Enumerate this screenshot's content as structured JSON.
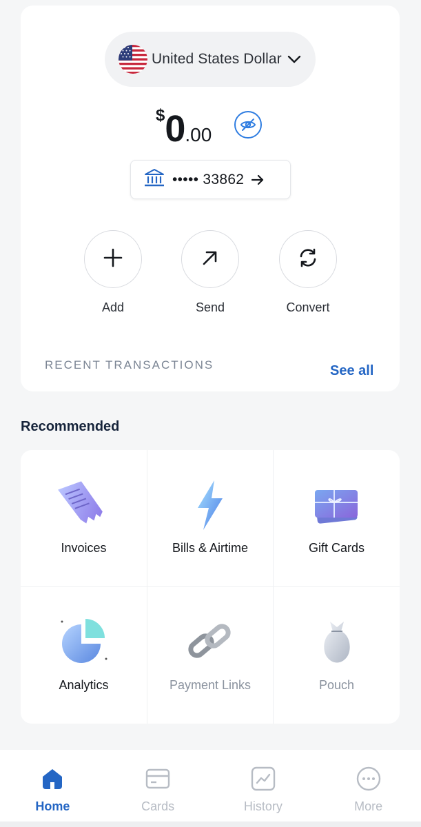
{
  "currency": {
    "label": "United States Dollar",
    "flag_icon": "us-flag-icon",
    "dropdown_icon": "chevron-down-icon"
  },
  "balance": {
    "symbol": "$",
    "integer": "0",
    "decimal": ".00",
    "toggle_icon": "eye-off-icon",
    "accent_color": "#2f7de1"
  },
  "account": {
    "icon": "bank-icon",
    "masked_number": "••••• 33862",
    "arrow_icon": "arrow-right-icon"
  },
  "actions": [
    {
      "label": "Add",
      "icon": "plus-icon"
    },
    {
      "label": "Send",
      "icon": "arrow-up-right-icon"
    },
    {
      "label": "Convert",
      "icon": "refresh-icon"
    }
  ],
  "recent_transactions": {
    "title": "RECENT TRANSACTIONS",
    "see_all": "See all"
  },
  "recommended": {
    "title": "Recommended",
    "items": [
      {
        "label": "Invoices",
        "icon": "invoice-icon",
        "enabled": true
      },
      {
        "label": "Bills & Airtime",
        "icon": "lightning-icon",
        "enabled": true
      },
      {
        "label": "Gift Cards",
        "icon": "gift-card-icon",
        "enabled": true
      },
      {
        "label": "Analytics",
        "icon": "pie-chart-icon",
        "enabled": true
      },
      {
        "label": "Payment Links",
        "icon": "link-icon",
        "enabled": false
      },
      {
        "label": "Pouch",
        "icon": "pouch-icon",
        "enabled": false
      }
    ]
  },
  "tabbar": {
    "active": "Home",
    "tabs": [
      {
        "label": "Home",
        "icon": "home-icon"
      },
      {
        "label": "Cards",
        "icon": "card-icon"
      },
      {
        "label": "History",
        "icon": "chart-icon"
      },
      {
        "label": "More",
        "icon": "more-icon"
      }
    ]
  },
  "colors": {
    "brand": "#2466c4",
    "muted": "#7b8594",
    "inactive_tab": "#b7bcc4"
  }
}
